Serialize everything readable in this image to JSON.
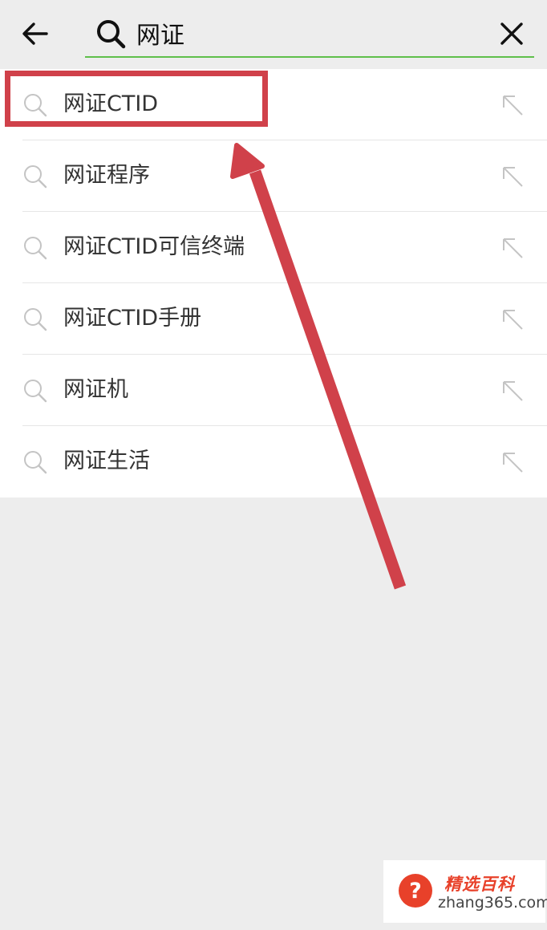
{
  "search": {
    "query": "网证",
    "accent_color": "#5fbf4b"
  },
  "icons": {
    "back": "arrow-left-icon",
    "search": "search-icon",
    "clear": "close-icon",
    "fill_query": "arrow-up-left-icon"
  },
  "suggestions": [
    {
      "label": "网证CTID"
    },
    {
      "label": "网证程序"
    },
    {
      "label": "网证CTID可信终端"
    },
    {
      "label": "网证CTID手册"
    },
    {
      "label": "网证机"
    },
    {
      "label": "网证生活"
    }
  ],
  "annotation": {
    "color": "#d0414a"
  },
  "watermark": {
    "name": "精选百科",
    "url": "zhang365.com",
    "badge_symbol": "?",
    "brand_color": "#e8412a"
  }
}
